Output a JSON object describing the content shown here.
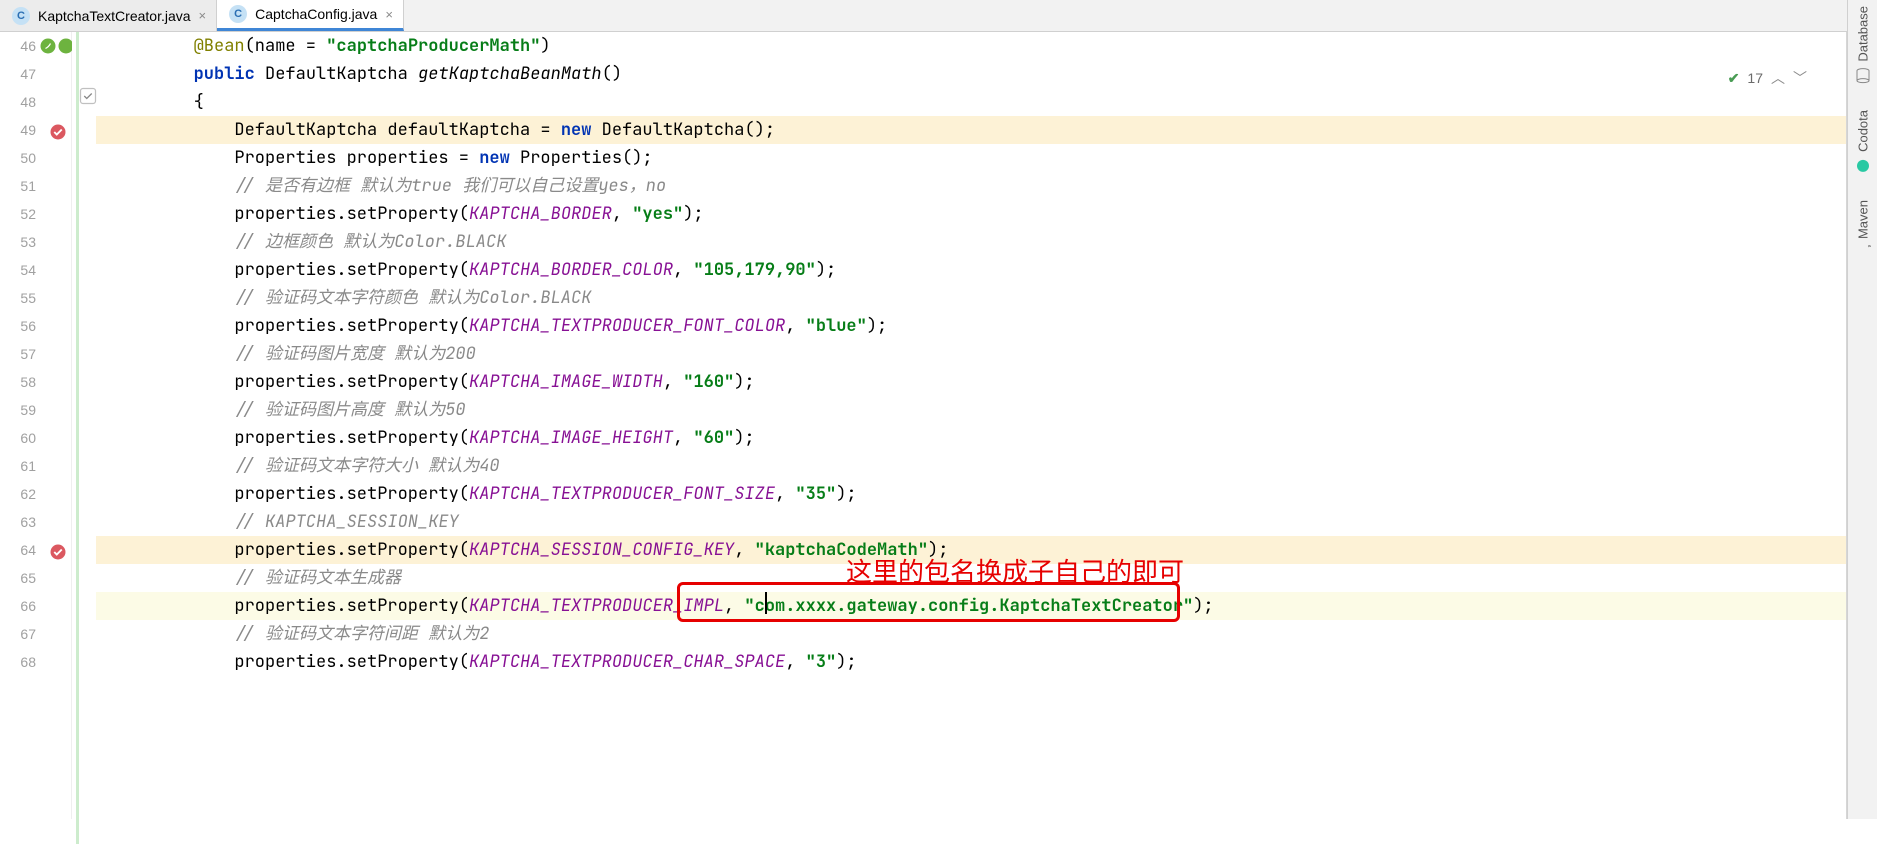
{
  "tabs": [
    {
      "icon": "C",
      "label": "KaptchaTextCreator.java",
      "active": false
    },
    {
      "icon": "C",
      "label": "CaptchaConfig.java",
      "active": true
    }
  ],
  "inspection": {
    "count": "17"
  },
  "rightbar": [
    {
      "label": "Database"
    },
    {
      "label": "Codota"
    },
    {
      "label": "Maven"
    }
  ],
  "annotation": "这里的包名换成子自己的即可",
  "lines": [
    {
      "n": "46",
      "indent": 2,
      "warn": false,
      "tokens": [
        {
          "t": "ann",
          "s": "@Bean"
        },
        {
          "t": "plain",
          "s": "(name = "
        },
        {
          "t": "str",
          "s": "\"captchaProducerMath\""
        },
        {
          "t": "plain",
          "s": ")"
        }
      ]
    },
    {
      "n": "47",
      "indent": 2,
      "tokens": [
        {
          "t": "kw",
          "s": "public "
        },
        {
          "t": "plain",
          "s": "DefaultKaptcha "
        },
        {
          "t": "fn",
          "s": "getKaptchaBeanMath"
        },
        {
          "t": "plain",
          "s": "()"
        }
      ]
    },
    {
      "n": "48",
      "indent": 2,
      "tokens": [
        {
          "t": "plain",
          "s": "{"
        }
      ]
    },
    {
      "n": "49",
      "indent": 3,
      "warn": true,
      "tokens": [
        {
          "t": "plain",
          "s": "DefaultKaptcha defaultKaptcha = "
        },
        {
          "t": "kw",
          "s": "new "
        },
        {
          "t": "plain",
          "s": "DefaultKaptcha();"
        }
      ]
    },
    {
      "n": "50",
      "indent": 3,
      "tokens": [
        {
          "t": "plain",
          "s": "Properties properties = "
        },
        {
          "t": "kw",
          "s": "new "
        },
        {
          "t": "plain",
          "s": "Properties();"
        }
      ]
    },
    {
      "n": "51",
      "indent": 3,
      "tokens": [
        {
          "t": "cmt",
          "s": "// 是否有边框 默认为true 我们可以自己设置yes，no"
        }
      ]
    },
    {
      "n": "52",
      "indent": 3,
      "tokens": [
        {
          "t": "plain",
          "s": "properties.setProperty("
        },
        {
          "t": "con",
          "s": "KAPTCHA_BORDER"
        },
        {
          "t": "plain",
          "s": ", "
        },
        {
          "t": "str",
          "s": "\"yes\""
        },
        {
          "t": "plain",
          "s": ");"
        }
      ]
    },
    {
      "n": "53",
      "indent": 3,
      "tokens": [
        {
          "t": "cmt",
          "s": "// 边框颜色 默认为Color.BLACK"
        }
      ]
    },
    {
      "n": "54",
      "indent": 3,
      "tokens": [
        {
          "t": "plain",
          "s": "properties.setProperty("
        },
        {
          "t": "con",
          "s": "KAPTCHA_BORDER_COLOR"
        },
        {
          "t": "plain",
          "s": ", "
        },
        {
          "t": "str",
          "s": "\"105,179,90\""
        },
        {
          "t": "plain",
          "s": ");"
        }
      ]
    },
    {
      "n": "55",
      "indent": 3,
      "tokens": [
        {
          "t": "cmt",
          "s": "// 验证码文本字符颜色 默认为Color.BLACK"
        }
      ]
    },
    {
      "n": "56",
      "indent": 3,
      "tokens": [
        {
          "t": "plain",
          "s": "properties.setProperty("
        },
        {
          "t": "con",
          "s": "KAPTCHA_TEXTPRODUCER_FONT_COLOR"
        },
        {
          "t": "plain",
          "s": ", "
        },
        {
          "t": "str",
          "s": "\"blue\""
        },
        {
          "t": "plain",
          "s": ");"
        }
      ]
    },
    {
      "n": "57",
      "indent": 3,
      "tokens": [
        {
          "t": "cmt",
          "s": "// 验证码图片宽度 默认为200"
        }
      ]
    },
    {
      "n": "58",
      "indent": 3,
      "tokens": [
        {
          "t": "plain",
          "s": "properties.setProperty("
        },
        {
          "t": "con",
          "s": "KAPTCHA_IMAGE_WIDTH"
        },
        {
          "t": "plain",
          "s": ", "
        },
        {
          "t": "str",
          "s": "\"160\""
        },
        {
          "t": "plain",
          "s": ");"
        }
      ]
    },
    {
      "n": "59",
      "indent": 3,
      "tokens": [
        {
          "t": "cmt",
          "s": "// 验证码图片高度 默认为50"
        }
      ]
    },
    {
      "n": "60",
      "indent": 3,
      "tokens": [
        {
          "t": "plain",
          "s": "properties.setProperty("
        },
        {
          "t": "con",
          "s": "KAPTCHA_IMAGE_HEIGHT"
        },
        {
          "t": "plain",
          "s": ", "
        },
        {
          "t": "str",
          "s": "\"60\""
        },
        {
          "t": "plain",
          "s": ");"
        }
      ]
    },
    {
      "n": "61",
      "indent": 3,
      "tokens": [
        {
          "t": "cmt",
          "s": "// 验证码文本字符大小 默认为40"
        }
      ]
    },
    {
      "n": "62",
      "indent": 3,
      "tokens": [
        {
          "t": "plain",
          "s": "properties.setProperty("
        },
        {
          "t": "con",
          "s": "KAPTCHA_TEXTPRODUCER_FONT_SIZE"
        },
        {
          "t": "plain",
          "s": ", "
        },
        {
          "t": "str",
          "s": "\"35\""
        },
        {
          "t": "plain",
          "s": ");"
        }
      ]
    },
    {
      "n": "63",
      "indent": 3,
      "tokens": [
        {
          "t": "cmt",
          "s": "// KAPTCHA_SESSION_KEY"
        }
      ]
    },
    {
      "n": "64",
      "indent": 3,
      "warn": true,
      "tokens": [
        {
          "t": "plain",
          "s": "properties.setProperty("
        },
        {
          "t": "con",
          "s": "KAPTCHA_SESSION_CONFIG_KEY"
        },
        {
          "t": "plain",
          "s": ", "
        },
        {
          "t": "str",
          "s": "\"kaptchaCodeMath\""
        },
        {
          "t": "plain",
          "s": ");"
        }
      ]
    },
    {
      "n": "65",
      "indent": 3,
      "tokens": [
        {
          "t": "cmt",
          "s": "// 验证码文本生成器"
        }
      ]
    },
    {
      "n": "66",
      "indent": 3,
      "cur": true,
      "tokens": [
        {
          "t": "plain",
          "s": "properties.setProperty("
        },
        {
          "t": "con",
          "s": "KAPTCHA_TEXTPRODUCER_IMPL"
        },
        {
          "t": "plain",
          "s": ", "
        },
        {
          "t": "str",
          "s": "\"com.xxxx.gateway.config.KaptchaTextCreator\""
        },
        {
          "t": "plain",
          "s": ");"
        }
      ]
    },
    {
      "n": "67",
      "indent": 3,
      "tokens": [
        {
          "t": "cmt",
          "s": "// 验证码文本字符间距 默认为2"
        }
      ]
    },
    {
      "n": "68",
      "indent": 3,
      "tokens": [
        {
          "t": "plain",
          "s": "properties.setProperty("
        },
        {
          "t": "con",
          "s": "KAPTCHA_TEXTPRODUCER_CHAR_SPACE"
        },
        {
          "t": "plain",
          "s": ", "
        },
        {
          "t": "str",
          "s": "\"3\""
        },
        {
          "t": "plain",
          "s": ");"
        }
      ]
    }
  ]
}
